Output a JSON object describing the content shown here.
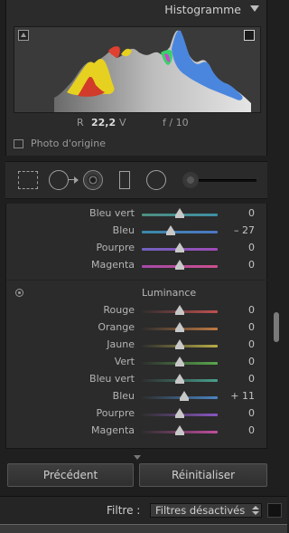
{
  "histogram": {
    "title": "Histogramme",
    "readout": {
      "r_label": "R",
      "r_value": "22,2",
      "v_label": "V",
      "f_label": "f / 10"
    },
    "original_photo_label": "Photo d'origine"
  },
  "tools": [
    "crop-overlay",
    "spot-removal",
    "red-eye",
    "graduated-filter",
    "radial-filter",
    "adjustment-brush"
  ],
  "hsl": {
    "hue_rows": [
      {
        "label": "Bleu vert",
        "value": "0",
        "pos": 0.5,
        "track": "linear-gradient(90deg,#4e8f80,#3e8fa4)"
      },
      {
        "label": "Bleu",
        "value": "– 27",
        "pos": 0.38,
        "track": "linear-gradient(90deg,#3a8aa8,#4d76c4)"
      },
      {
        "label": "Pourpre",
        "value": "0",
        "pos": 0.5,
        "track": "linear-gradient(90deg,#6f62c0,#a04bb6)"
      },
      {
        "label": "Magenta",
        "value": "0",
        "pos": 0.5,
        "track": "linear-gradient(90deg,#a64aa9,#c9508d)"
      }
    ],
    "luminance_title": "Luminance",
    "luminance_rows": [
      {
        "label": "Rouge",
        "value": "0",
        "pos": 0.5,
        "track": "linear-gradient(90deg,#2e2e2e,#c05050)"
      },
      {
        "label": "Orange",
        "value": "0",
        "pos": 0.5,
        "track": "linear-gradient(90deg,#2e2e2e,#c07a42)"
      },
      {
        "label": "Jaune",
        "value": "0",
        "pos": 0.5,
        "track": "linear-gradient(90deg,#2e2e2e,#b7ad46)"
      },
      {
        "label": "Vert",
        "value": "0",
        "pos": 0.5,
        "track": "linear-gradient(90deg,#2e2e2e,#58a94c)"
      },
      {
        "label": "Bleu vert",
        "value": "0",
        "pos": 0.5,
        "track": "linear-gradient(90deg,#2e2e2e,#48a08e)"
      },
      {
        "label": "Bleu",
        "value": "+ 11",
        "pos": 0.56,
        "track": "linear-gradient(90deg,#2e2e2e,#4b84c2)"
      },
      {
        "label": "Pourpre",
        "value": "0",
        "pos": 0.5,
        "track": "linear-gradient(90deg,#2e2e2e,#8a56c0)"
      },
      {
        "label": "Magenta",
        "value": "0",
        "pos": 0.5,
        "track": "linear-gradient(90deg,#2e2e2e,#c04e9e)"
      }
    ]
  },
  "buttons": {
    "previous": "Précédent",
    "reset": "Réinitialiser"
  },
  "filter": {
    "label": "Filtre :",
    "value": "Filtres désactivés"
  }
}
